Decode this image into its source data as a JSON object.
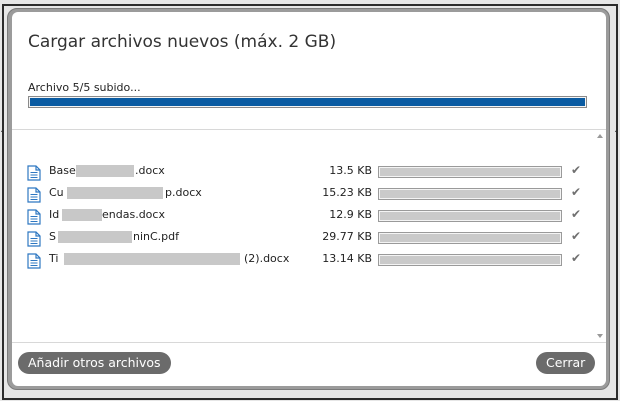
{
  "dialog": {
    "title": "Cargar archivos nuevos (máx. 2 GB)",
    "progress": {
      "label": "Archivo 5/5 subido...",
      "fraction": 1.0,
      "fill_color": "#0a5ba2"
    },
    "files": [
      {
        "name_start": "Base",
        "name_end": ".docx",
        "size": "13.5 KB",
        "progress": 1.0,
        "status": "done"
      },
      {
        "name_start": "Cu",
        "name_end": "p.docx",
        "size": "15.23 KB",
        "progress": 1.0,
        "status": "done"
      },
      {
        "name_start": "Id",
        "name_end": "endas.docx",
        "size": "12.9 KB",
        "progress": 1.0,
        "status": "done"
      },
      {
        "name_start": "S",
        "name_end": "ninC.pdf",
        "size": "29.77 KB",
        "progress": 1.0,
        "status": "done"
      },
      {
        "name_start": "Ti",
        "name_end": "(2).docx",
        "size": "13.14 KB",
        "progress": 1.0,
        "status": "done"
      }
    ],
    "buttons": {
      "add_label": "Añadir otros archivos",
      "close_label": "Cerrar"
    },
    "icons": {
      "file": "document-icon",
      "status_done": "checkmark-icon"
    },
    "colors": {
      "button_bg": "#6b6b6b",
      "file_icon": "#2f78c2",
      "row_bar_fill": "#cacaca"
    }
  }
}
